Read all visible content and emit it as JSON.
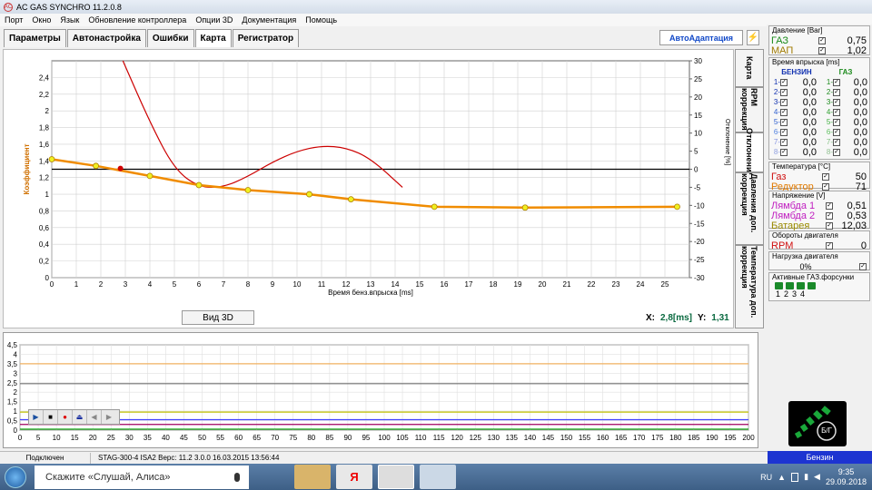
{
  "window": {
    "title": "AC GAS SYNCHRO  11.2.0.8"
  },
  "menu": [
    "Порт",
    "Окно",
    "Язык",
    "Обновление контроллера",
    "Опции 3D",
    "Документация",
    "Помощь"
  ],
  "tabs": [
    "Параметры",
    "Автонастройка",
    "Ошибки",
    "Карта",
    "Регистратор"
  ],
  "autoadapt_label": "АвтоАдаптация",
  "side_tabs": [
    "Карта",
    "RPM коррекция",
    "Отклонение",
    "Давления доп. коррекция",
    "Температура доп. коррекция"
  ],
  "view3d_label": "Вид 3D",
  "cursor": {
    "x_label": "X:",
    "x_value": "2,8[ms]",
    "y_label": "Y:",
    "y_value": "1,31"
  },
  "chart_data": [
    {
      "type": "line",
      "xlabel": "Время бенз.впрыска [ms]",
      "ylabel": "Коэффициент",
      "y2label": "Отклонение [%]",
      "xlim": [
        0,
        26
      ],
      "ylim": [
        0,
        2.6
      ],
      "y2lim": [
        -30,
        30
      ],
      "x_ticks": [
        0,
        1,
        2,
        3,
        4,
        5,
        6,
        7,
        8,
        9,
        10,
        11,
        12,
        13,
        14,
        15,
        16,
        17,
        18,
        19,
        20,
        21,
        22,
        23,
        24,
        25
      ],
      "y_ticks": [
        "0",
        "0,2",
        "0,4",
        "0,6",
        "0,8",
        "1",
        "1,2",
        "1,4",
        "1,6",
        "1,8",
        "2",
        "2,2",
        "2,4"
      ],
      "y2_ticks": [
        "-30",
        "-25",
        "-20",
        "-15",
        "-10",
        "-5",
        "0",
        "5",
        "10",
        "15",
        "20",
        "25",
        "30"
      ],
      "grid": true,
      "series": [
        {
          "color": "#f08c00",
          "x": [
            0,
            1.8,
            4,
            6,
            8,
            10.5,
            12.2,
            15.6,
            19.3,
            25.5
          ],
          "y": [
            1.42,
            1.34,
            1.22,
            1.11,
            1.05,
            1.0,
            0.94,
            0.85,
            0.84,
            0.85
          ]
        },
        {
          "color": "#cc0000",
          "axis": "y2",
          "x": [
            2.9,
            4,
            5,
            6,
            7,
            8,
            9,
            10,
            11,
            12,
            13,
            14.3
          ],
          "y": [
            30,
            13,
            0,
            -5,
            -5,
            -2,
            2,
            5,
            6.5,
            6,
            3,
            -5
          ]
        },
        {
          "color": "#000000",
          "axis": "y2",
          "x": [
            0,
            26
          ],
          "y": [
            0,
            0
          ]
        }
      ],
      "highlight_point": {
        "x": 2.8,
        "y": 1.31
      }
    },
    {
      "type": "line",
      "xlim": [
        0,
        200
      ],
      "ylim": [
        0,
        4.5
      ],
      "x_ticks": [
        0,
        5,
        10,
        15,
        20,
        25,
        30,
        35,
        40,
        45,
        50,
        55,
        60,
        65,
        70,
        75,
        80,
        85,
        90,
        95,
        100,
        105,
        110,
        115,
        120,
        125,
        130,
        135,
        140,
        145,
        150,
        155,
        160,
        165,
        170,
        175,
        180,
        185,
        190,
        195,
        200
      ],
      "y_ticks": [
        "0",
        "0,5",
        "1",
        "1,5",
        "2",
        "2,5",
        "3",
        "3,5",
        "4",
        "4,5"
      ],
      "grid": true,
      "series": [
        {
          "color": "#f0b060",
          "y": 3.5
        },
        {
          "color": "#707070",
          "y": 2.45
        },
        {
          "color": "#c0c000",
          "y": 0.95
        },
        {
          "color": "#4040ff",
          "y": 0.55
        },
        {
          "color": "#a00060",
          "y": 0.3
        },
        {
          "color": "#00a000",
          "y": 0.05
        }
      ]
    }
  ],
  "pressure": {
    "title": "Давление [Bar]",
    "gas_label": "ГАЗ",
    "gas_value": "0,75",
    "map_label": "МАП",
    "map_value": "1,02"
  },
  "injection": {
    "title": "Время впрыска [ms]",
    "petrol_label": "БЕНЗИН",
    "gas_label": "ГАЗ",
    "rows": [
      {
        "n": "1-",
        "p": "0,0",
        "g": "0,0"
      },
      {
        "n": "2-",
        "p": "0,0",
        "g": "0,0"
      },
      {
        "n": "3-",
        "p": "0,0",
        "g": "0,0"
      },
      {
        "n": "4-",
        "p": "0,0",
        "g": "0,0"
      },
      {
        "n": "5-",
        "p": "0,0",
        "g": "0,0"
      },
      {
        "n": "6-",
        "p": "0,0",
        "g": "0,0"
      },
      {
        "n": "7-",
        "p": "0,0",
        "g": "0,0"
      },
      {
        "n": "8-",
        "p": "0,0",
        "g": "0,0"
      }
    ]
  },
  "temperature": {
    "title": "Температура [°C]",
    "gas_label": "Газ",
    "gas_value": "50",
    "reducer_label": "Редуктор",
    "reducer_value": "71"
  },
  "voltage": {
    "title": "Напряжение [V]",
    "lambda1_label": "Лямбда 1",
    "lambda1_value": "0,51",
    "lambda2_label": "Лямбда 2",
    "lambda2_value": "0,53",
    "battery_label": "Батарея",
    "battery_value": "12,03"
  },
  "rpm": {
    "title": "Обороты двигателя",
    "label": "RPM",
    "value": "0"
  },
  "load": {
    "title": "Нагрузка двигателя",
    "value": "0%"
  },
  "injectors": {
    "title": "Активные ГАЗ.форсунки",
    "labels": [
      "1",
      "2",
      "3",
      "4"
    ]
  },
  "switch_label": "Б/Г",
  "status": {
    "connection": "Подключен",
    "device": "STAG-300-4 ISA2  Верс: 11.2  3.0.0    16.03.2015 13:56:44",
    "fuel": "Бензин"
  },
  "taskbar": {
    "search_text": "Скажите «Слушай, Алиса»",
    "lang": "RU",
    "time": "9:35",
    "date": "29.09.2018",
    "ya_label": "Я"
  }
}
